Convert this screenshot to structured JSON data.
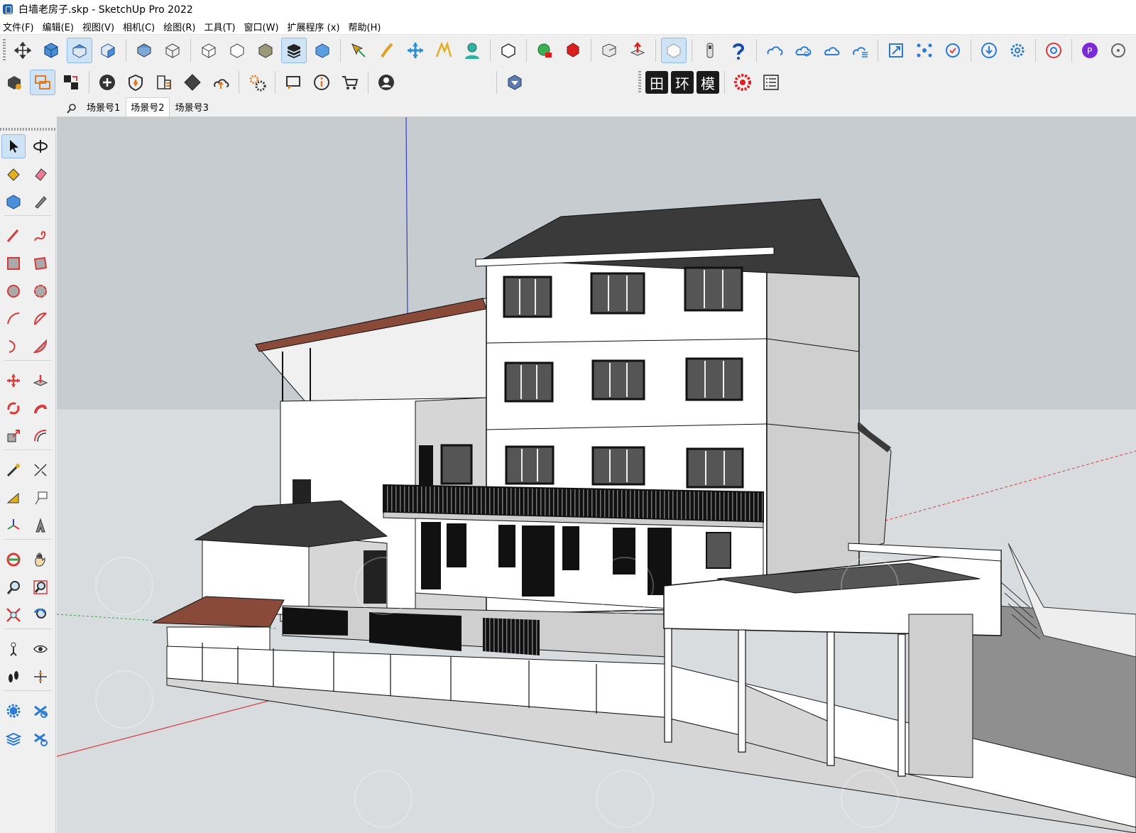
{
  "window": {
    "title": "白墙老房子.skp - SketchUp Pro 2022"
  },
  "menu": [
    "文件(F)",
    "编辑(E)",
    "视图(V)",
    "相机(C)",
    "绘图(R)",
    "工具(T)",
    "窗口(W)",
    "扩展程序 (x)",
    "帮助(H)"
  ],
  "toolbar2_text": [
    "田",
    "环",
    "模"
  ],
  "scenes": {
    "active_index": 1,
    "tabs": [
      "场景号1",
      "场景号2",
      "场景号3"
    ]
  },
  "icons": {
    "toolbar1": [
      "select-view-icon",
      "iso-view-icon",
      "top-view-icon",
      "front-view-icon",
      "right-view-icon",
      "xray-icon",
      "wireframe-icon",
      "hidden-line-icon",
      "shaded-icon",
      "textured-icon",
      "monochrome-icon",
      "section-plane-icon",
      "section-cut-icon",
      "position-camera-icon",
      "walk-icon",
      "look-around-icon",
      "component-icon",
      "group-add-icon",
      "group-subtract-icon",
      "eraser-box-icon",
      "push-pull-red-icon",
      "soften-icon",
      "tape-icon",
      "help-icon",
      "cloud-sync-icon",
      "cloud-share-icon",
      "cloud-icon",
      "cloud-list-icon",
      "scale-icon",
      "network-icon",
      "refresh-check-icon",
      "download-icon",
      "settings-icon",
      "chrome-icon",
      "profile-icon",
      "history-icon"
    ],
    "toolbar2": [
      "warehouse-icon",
      "swap-icon",
      "component-swap-icon",
      "add-circle-icon",
      "shield-icon",
      "hatch-icon",
      "checker-icon",
      "upload-cloud-icon",
      "gears-icon",
      "message-icon",
      "info-icon",
      "cart-icon",
      "user-icon",
      "cube-select-icon",
      "grid-button",
      "ring-button",
      "model-button",
      "star-gear-icon",
      "list-icon"
    ]
  },
  "colors": {
    "sky": "#c7ccd0",
    "ground": "#d9dcdf",
    "roof": "#3a3a3a",
    "tile_roof": "#8a4a3a",
    "wall": "#ffffff",
    "shade": "#cfcfcf",
    "axis_red": "#d83a3a",
    "axis_green": "#3aa04a",
    "axis_blue": "#3040c0"
  }
}
